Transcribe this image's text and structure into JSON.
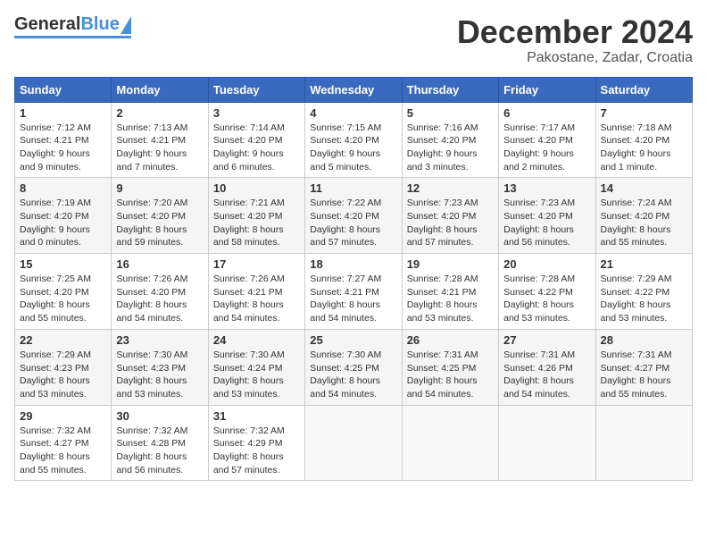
{
  "header": {
    "logo_general": "General",
    "logo_blue": "Blue",
    "title": "December 2024",
    "subtitle": "Pakostane, Zadar, Croatia"
  },
  "days_of_week": [
    "Sunday",
    "Monday",
    "Tuesday",
    "Wednesday",
    "Thursday",
    "Friday",
    "Saturday"
  ],
  "weeks": [
    [
      {
        "day": "1",
        "sunrise": "Sunrise: 7:12 AM",
        "sunset": "Sunset: 4:21 PM",
        "daylight": "Daylight: 9 hours and 9 minutes."
      },
      {
        "day": "2",
        "sunrise": "Sunrise: 7:13 AM",
        "sunset": "Sunset: 4:21 PM",
        "daylight": "Daylight: 9 hours and 7 minutes."
      },
      {
        "day": "3",
        "sunrise": "Sunrise: 7:14 AM",
        "sunset": "Sunset: 4:20 PM",
        "daylight": "Daylight: 9 hours and 6 minutes."
      },
      {
        "day": "4",
        "sunrise": "Sunrise: 7:15 AM",
        "sunset": "Sunset: 4:20 PM",
        "daylight": "Daylight: 9 hours and 5 minutes."
      },
      {
        "day": "5",
        "sunrise": "Sunrise: 7:16 AM",
        "sunset": "Sunset: 4:20 PM",
        "daylight": "Daylight: 9 hours and 3 minutes."
      },
      {
        "day": "6",
        "sunrise": "Sunrise: 7:17 AM",
        "sunset": "Sunset: 4:20 PM",
        "daylight": "Daylight: 9 hours and 2 minutes."
      },
      {
        "day": "7",
        "sunrise": "Sunrise: 7:18 AM",
        "sunset": "Sunset: 4:20 PM",
        "daylight": "Daylight: 9 hours and 1 minute."
      }
    ],
    [
      {
        "day": "8",
        "sunrise": "Sunrise: 7:19 AM",
        "sunset": "Sunset: 4:20 PM",
        "daylight": "Daylight: 9 hours and 0 minutes."
      },
      {
        "day": "9",
        "sunrise": "Sunrise: 7:20 AM",
        "sunset": "Sunset: 4:20 PM",
        "daylight": "Daylight: 8 hours and 59 minutes."
      },
      {
        "day": "10",
        "sunrise": "Sunrise: 7:21 AM",
        "sunset": "Sunset: 4:20 PM",
        "daylight": "Daylight: 8 hours and 58 minutes."
      },
      {
        "day": "11",
        "sunrise": "Sunrise: 7:22 AM",
        "sunset": "Sunset: 4:20 PM",
        "daylight": "Daylight: 8 hours and 57 minutes."
      },
      {
        "day": "12",
        "sunrise": "Sunrise: 7:23 AM",
        "sunset": "Sunset: 4:20 PM",
        "daylight": "Daylight: 8 hours and 57 minutes."
      },
      {
        "day": "13",
        "sunrise": "Sunrise: 7:23 AM",
        "sunset": "Sunset: 4:20 PM",
        "daylight": "Daylight: 8 hours and 56 minutes."
      },
      {
        "day": "14",
        "sunrise": "Sunrise: 7:24 AM",
        "sunset": "Sunset: 4:20 PM",
        "daylight": "Daylight: 8 hours and 55 minutes."
      }
    ],
    [
      {
        "day": "15",
        "sunrise": "Sunrise: 7:25 AM",
        "sunset": "Sunset: 4:20 PM",
        "daylight": "Daylight: 8 hours and 55 minutes."
      },
      {
        "day": "16",
        "sunrise": "Sunrise: 7:26 AM",
        "sunset": "Sunset: 4:20 PM",
        "daylight": "Daylight: 8 hours and 54 minutes."
      },
      {
        "day": "17",
        "sunrise": "Sunrise: 7:26 AM",
        "sunset": "Sunset: 4:21 PM",
        "daylight": "Daylight: 8 hours and 54 minutes."
      },
      {
        "day": "18",
        "sunrise": "Sunrise: 7:27 AM",
        "sunset": "Sunset: 4:21 PM",
        "daylight": "Daylight: 8 hours and 54 minutes."
      },
      {
        "day": "19",
        "sunrise": "Sunrise: 7:28 AM",
        "sunset": "Sunset: 4:21 PM",
        "daylight": "Daylight: 8 hours and 53 minutes."
      },
      {
        "day": "20",
        "sunrise": "Sunrise: 7:28 AM",
        "sunset": "Sunset: 4:22 PM",
        "daylight": "Daylight: 8 hours and 53 minutes."
      },
      {
        "day": "21",
        "sunrise": "Sunrise: 7:29 AM",
        "sunset": "Sunset: 4:22 PM",
        "daylight": "Daylight: 8 hours and 53 minutes."
      }
    ],
    [
      {
        "day": "22",
        "sunrise": "Sunrise: 7:29 AM",
        "sunset": "Sunset: 4:23 PM",
        "daylight": "Daylight: 8 hours and 53 minutes."
      },
      {
        "day": "23",
        "sunrise": "Sunrise: 7:30 AM",
        "sunset": "Sunset: 4:23 PM",
        "daylight": "Daylight: 8 hours and 53 minutes."
      },
      {
        "day": "24",
        "sunrise": "Sunrise: 7:30 AM",
        "sunset": "Sunset: 4:24 PM",
        "daylight": "Daylight: 8 hours and 53 minutes."
      },
      {
        "day": "25",
        "sunrise": "Sunrise: 7:30 AM",
        "sunset": "Sunset: 4:25 PM",
        "daylight": "Daylight: 8 hours and 54 minutes."
      },
      {
        "day": "26",
        "sunrise": "Sunrise: 7:31 AM",
        "sunset": "Sunset: 4:25 PM",
        "daylight": "Daylight: 8 hours and 54 minutes."
      },
      {
        "day": "27",
        "sunrise": "Sunrise: 7:31 AM",
        "sunset": "Sunset: 4:26 PM",
        "daylight": "Daylight: 8 hours and 54 minutes."
      },
      {
        "day": "28",
        "sunrise": "Sunrise: 7:31 AM",
        "sunset": "Sunset: 4:27 PM",
        "daylight": "Daylight: 8 hours and 55 minutes."
      }
    ],
    [
      {
        "day": "29",
        "sunrise": "Sunrise: 7:32 AM",
        "sunset": "Sunset: 4:27 PM",
        "daylight": "Daylight: 8 hours and 55 minutes."
      },
      {
        "day": "30",
        "sunrise": "Sunrise: 7:32 AM",
        "sunset": "Sunset: 4:28 PM",
        "daylight": "Daylight: 8 hours and 56 minutes."
      },
      {
        "day": "31",
        "sunrise": "Sunrise: 7:32 AM",
        "sunset": "Sunset: 4:29 PM",
        "daylight": "Daylight: 8 hours and 57 minutes."
      },
      null,
      null,
      null,
      null
    ]
  ]
}
